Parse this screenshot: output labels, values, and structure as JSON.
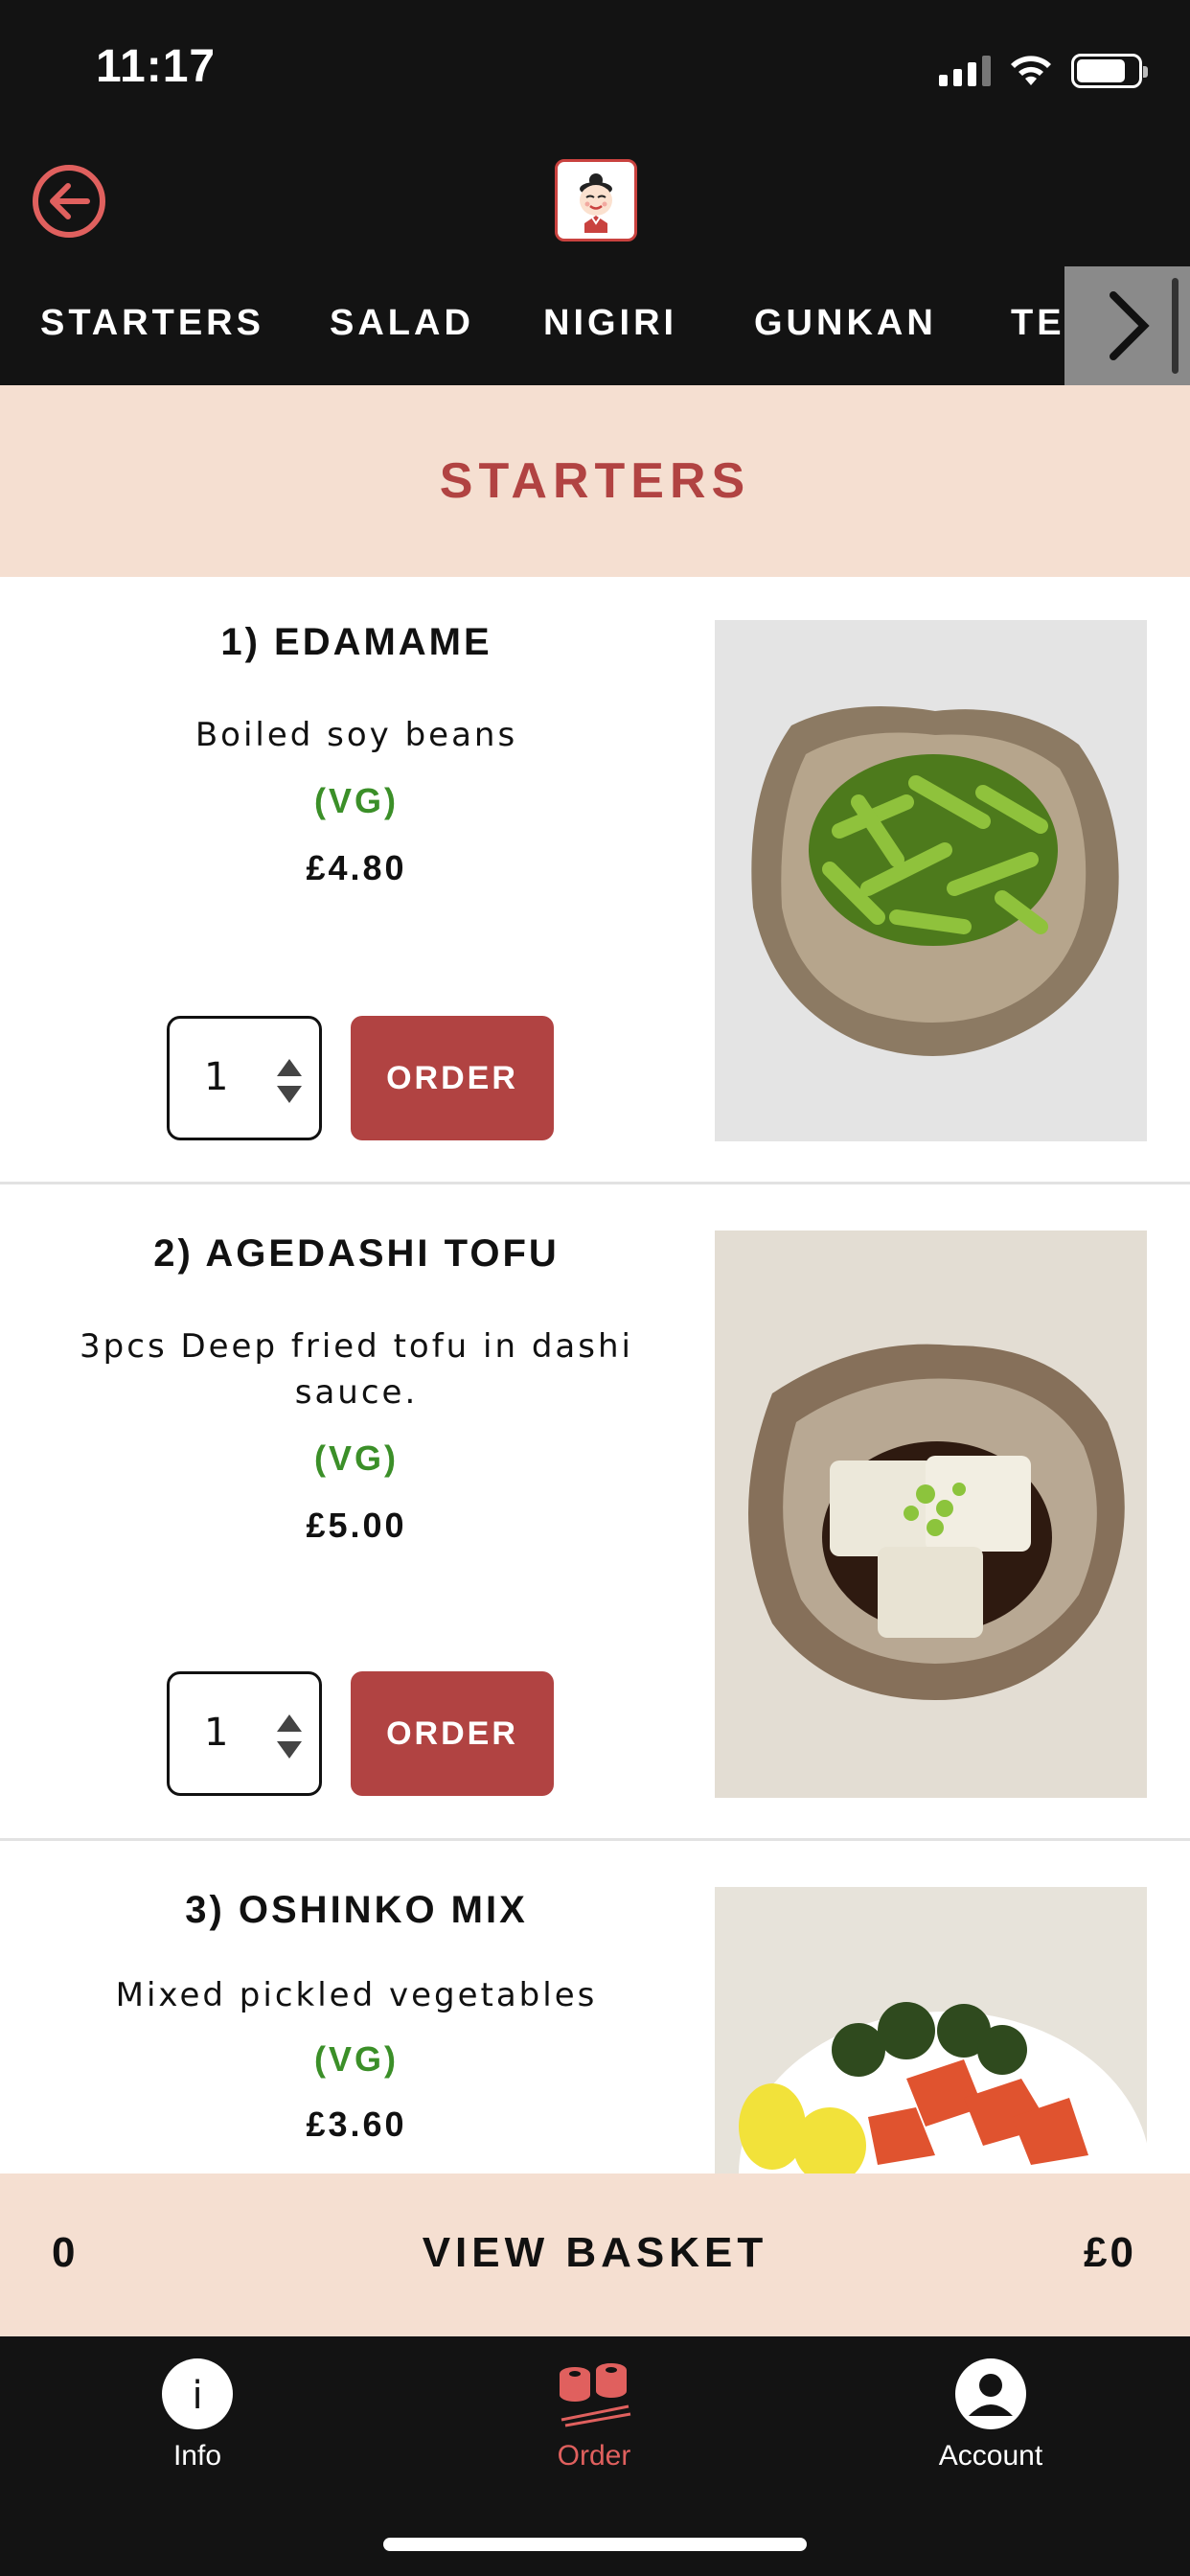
{
  "status_bar": {
    "time": "11:17"
  },
  "header": {
    "back_icon": "arrow-left-circle-icon",
    "logo_icon": "sushi-chef-logo-icon"
  },
  "categories": [
    "STARTERS",
    "SALAD",
    "NIGIRI",
    "GUNKAN",
    "TEMAKI"
  ],
  "section_title": "STARTERS",
  "items": [
    {
      "name": "1) EDAMAME",
      "description": "Boiled soy beans",
      "tag": "(VG)",
      "price": "£4.80",
      "quantity": "1",
      "order_label": "ORDER",
      "photo": "edamame-photo"
    },
    {
      "name": "2) AGEDASHI TOFU",
      "description": "3pcs Deep fried tofu in dashi sauce.",
      "tag": "(VG)",
      "price": "£5.00",
      "quantity": "1",
      "order_label": "ORDER",
      "photo": "agedashi-tofu-photo"
    },
    {
      "name": "3) OSHINKO MIX",
      "description": "Mixed pickled vegetables",
      "tag": "(VG)",
      "price": "£3.60",
      "photo": "oshinko-mix-photo"
    }
  ],
  "basket": {
    "count": "0",
    "label": "VIEW BASKET",
    "total": "£0"
  },
  "nav": [
    {
      "label": "Info",
      "icon": "info-icon"
    },
    {
      "label": "Order",
      "icon": "sushi-icon",
      "active": true
    },
    {
      "label": "Account",
      "icon": "account-icon"
    }
  ],
  "colors": {
    "accent": "#b14342",
    "section_bg": "#f5dfd1",
    "dark": "#131313",
    "veg": "#3b8f28",
    "active_nav": "#e0605e"
  }
}
